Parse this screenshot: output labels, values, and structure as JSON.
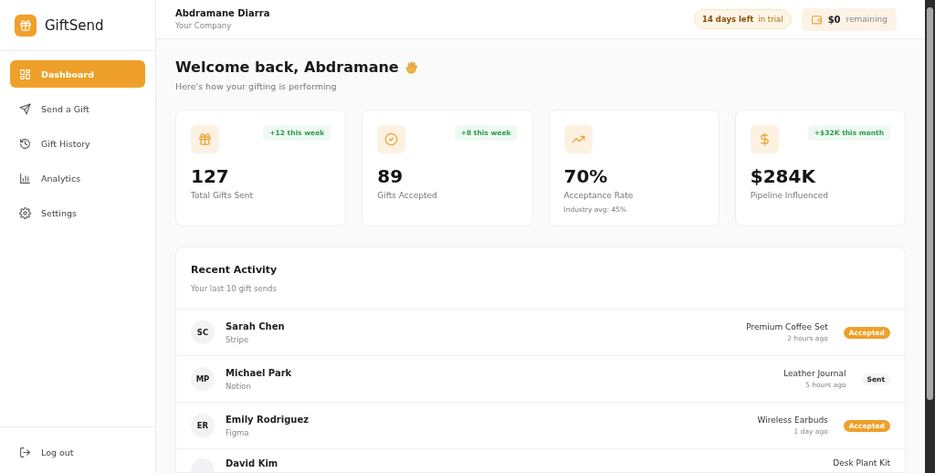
{
  "app": {
    "name": "GiftSend"
  },
  "sidebar": {
    "items": [
      {
        "label": "Dashboard",
        "selected": true
      },
      {
        "label": "Send a Gift",
        "selected": false
      },
      {
        "label": "Gift History",
        "selected": false
      },
      {
        "label": "Analytics",
        "selected": false
      },
      {
        "label": "Settings",
        "selected": false
      }
    ],
    "footer_items": [
      {
        "label": "Log out"
      }
    ]
  },
  "header": {
    "user_name": "Abdramane Diarra",
    "company": "Your Company",
    "trial": {
      "strong": "14 days left",
      "rest": "in trial"
    },
    "balance": {
      "amount": "$0",
      "rest": "remaining"
    }
  },
  "welcome": {
    "title": "Welcome back, Abdramane",
    "subtitle": "Here's how your gifting is performing"
  },
  "stats": [
    {
      "value": "127",
      "label": "Total Gifts Sent",
      "delta": "+12 this week"
    },
    {
      "value": "89",
      "label": "Gifts Accepted",
      "delta": "+8 this week"
    },
    {
      "value": "70%",
      "label": "Acceptance Rate",
      "note": "Industry avg: 45%"
    },
    {
      "value": "$284K",
      "label": "Pipeline Influenced",
      "delta": "+$32K this month"
    }
  ],
  "activity": {
    "title": "Recent Activity",
    "subtitle": "Your last 10 gift sends",
    "rows": [
      {
        "initials": "SC",
        "name": "Sarah Chen",
        "company": "Stripe",
        "gift": "Premium Coffee Set",
        "time": "2 hours ago",
        "status": {
          "label": "Accepted",
          "kind": "accepted"
        }
      },
      {
        "initials": "MP",
        "name": "Michael Park",
        "company": "Notion",
        "gift": "Leather Journal",
        "time": "5 hours ago",
        "status": {
          "label": "Sent",
          "kind": "sent"
        }
      },
      {
        "initials": "ER",
        "name": "Emily Rodriguez",
        "company": "Figma",
        "gift": "Wireless Earbuds",
        "time": "1 day ago",
        "status": {
          "label": "Accepted",
          "kind": "accepted"
        }
      },
      {
        "name": "David Kim",
        "gift": "Desk Plant Kit"
      }
    ]
  }
}
